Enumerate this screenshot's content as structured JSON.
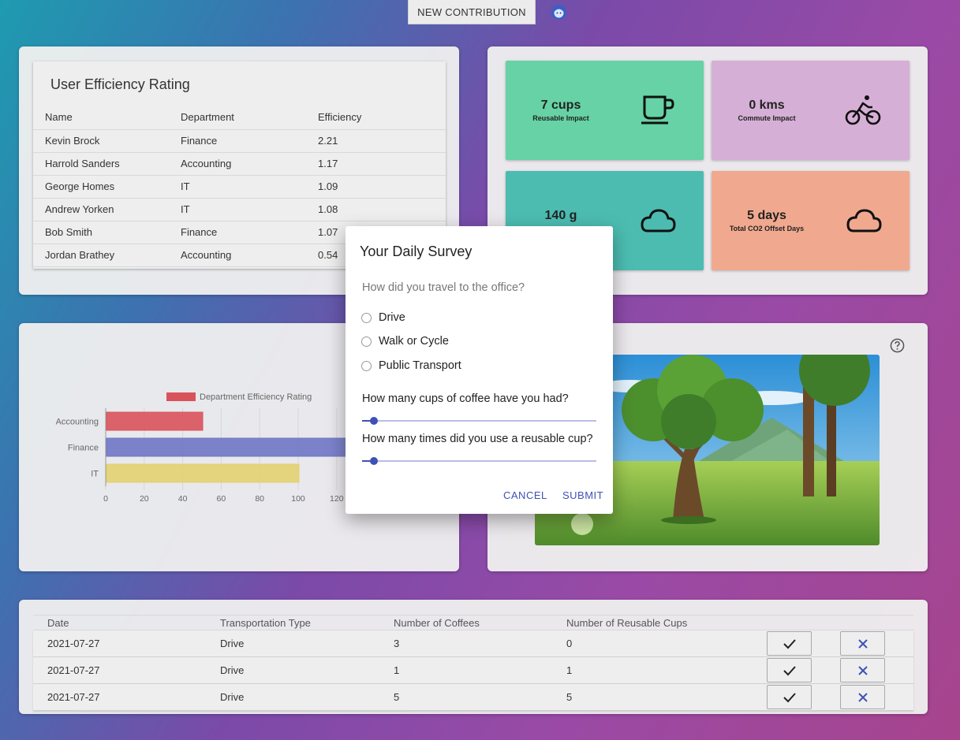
{
  "topbar": {
    "new_contribution_label": "NEW CONTRIBUTION"
  },
  "efficiency": {
    "title": "User Efficiency Rating",
    "columns": [
      "Name",
      "Department",
      "Efficiency"
    ],
    "rows": [
      [
        "Kevin Brock",
        "Finance",
        "2.21"
      ],
      [
        "Harrold Sanders",
        "Accounting",
        "1.17"
      ],
      [
        "George Homes",
        "IT",
        "1.09"
      ],
      [
        "Andrew Yorken",
        "IT",
        "1.08"
      ],
      [
        "Bob Smith",
        "Finance",
        "1.07"
      ],
      [
        "Jordan Brathey",
        "Accounting",
        "0.54"
      ]
    ]
  },
  "tiles": [
    {
      "value": "7 cups",
      "label": "Reusable Impact",
      "icon": "coffee-cup-icon",
      "color": "#66d2a5"
    },
    {
      "value": "0 kms",
      "label": "Commute Impact",
      "icon": "bicycle-icon",
      "color": "#d6afd6"
    },
    {
      "value": "140 g",
      "label": "",
      "icon": "cloud-icon",
      "color": "#4cbcb1"
    },
    {
      "value": "5 days",
      "label": "Total CO2 Offset Days",
      "icon": "cloud-icon",
      "color": "#f0a98f"
    }
  ],
  "chart_data": {
    "type": "bar",
    "orientation": "horizontal",
    "categories": [
      "Accounting",
      "Finance",
      "IT"
    ],
    "series": [
      {
        "name": "Department Efficiency Rating",
        "values": [
          50,
          140,
          100
        ],
        "colors": [
          "#d9535d",
          "#7077c7",
          "#e2d171"
        ]
      }
    ],
    "xticks": [
      "0",
      "20",
      "40",
      "60",
      "80",
      "100",
      "120"
    ],
    "xlim": [
      0,
      140
    ],
    "legend": "top",
    "grid": true
  },
  "history": {
    "columns": [
      "Date",
      "Transportation Type",
      "Number of Coffees",
      "Number of Reusable Cups"
    ],
    "rows": [
      [
        "2021-07-27",
        "Drive",
        "3",
        "0"
      ],
      [
        "2021-07-27",
        "Drive",
        "1",
        "1"
      ],
      [
        "2021-07-27",
        "Drive",
        "5",
        "5"
      ]
    ]
  },
  "dialog": {
    "title": "Your Daily Survey",
    "question_travel": "How did you travel to the office?",
    "options": [
      "Drive",
      "Walk or Cycle",
      "Public Transport"
    ],
    "question_coffee": "How many cups of coffee have you had?",
    "question_reusable": "How many times did you use a reusable cup?",
    "coffee_value": 0,
    "reusable_value": 0,
    "cancel_label": "CANCEL",
    "submit_label": "SUBMIT"
  }
}
